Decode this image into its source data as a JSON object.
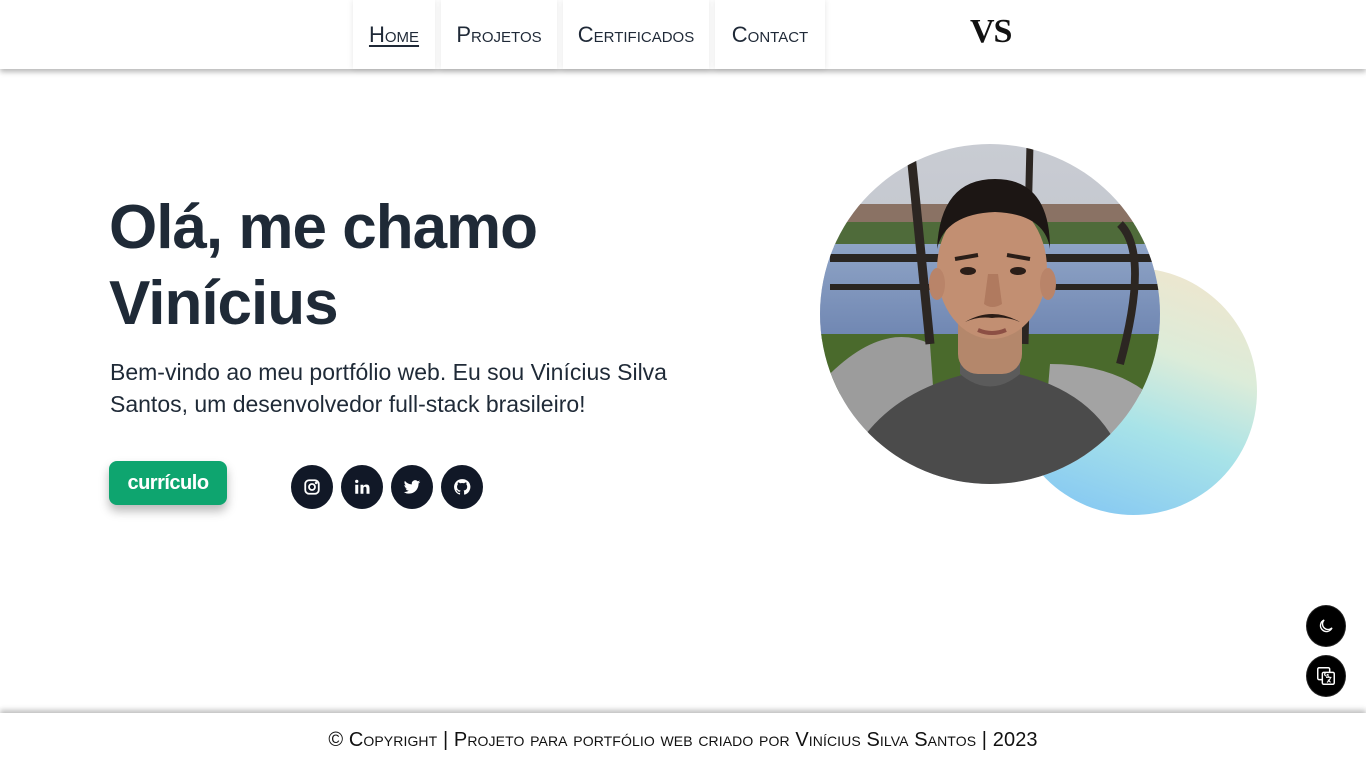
{
  "nav": {
    "items": [
      {
        "label": "Home",
        "active": true
      },
      {
        "label": "Projetos",
        "active": false
      },
      {
        "label": "Certificados",
        "active": false
      },
      {
        "label": "Contact",
        "active": false
      }
    ],
    "logo": "VS"
  },
  "hero": {
    "title": "Olá, me chamo Vinícius",
    "description": "Bem-vindo ao meu portfólio web. Eu sou Vinícius Silva Santos, um desenvolvedor full-stack brasileiro!",
    "cv_button": "currículo",
    "socials": [
      {
        "icon": "instagram-icon"
      },
      {
        "icon": "linkedin-icon"
      },
      {
        "icon": "twitter-icon"
      },
      {
        "icon": "github-icon"
      }
    ]
  },
  "photo": {
    "gradient_colors": [
      "#f3e4cb",
      "#a8e3e8",
      "#7ec2f5"
    ]
  },
  "floating": {
    "theme_icon": "moon-icon",
    "language_icon": "translate-icon"
  },
  "footer": {
    "text": "© Copyright | Projeto para portfólio web criado por Vinícius Silva Santos | 2023"
  },
  "colors": {
    "accent": "#0ea56f",
    "dark": "#111827",
    "text": "#1f2a37"
  }
}
